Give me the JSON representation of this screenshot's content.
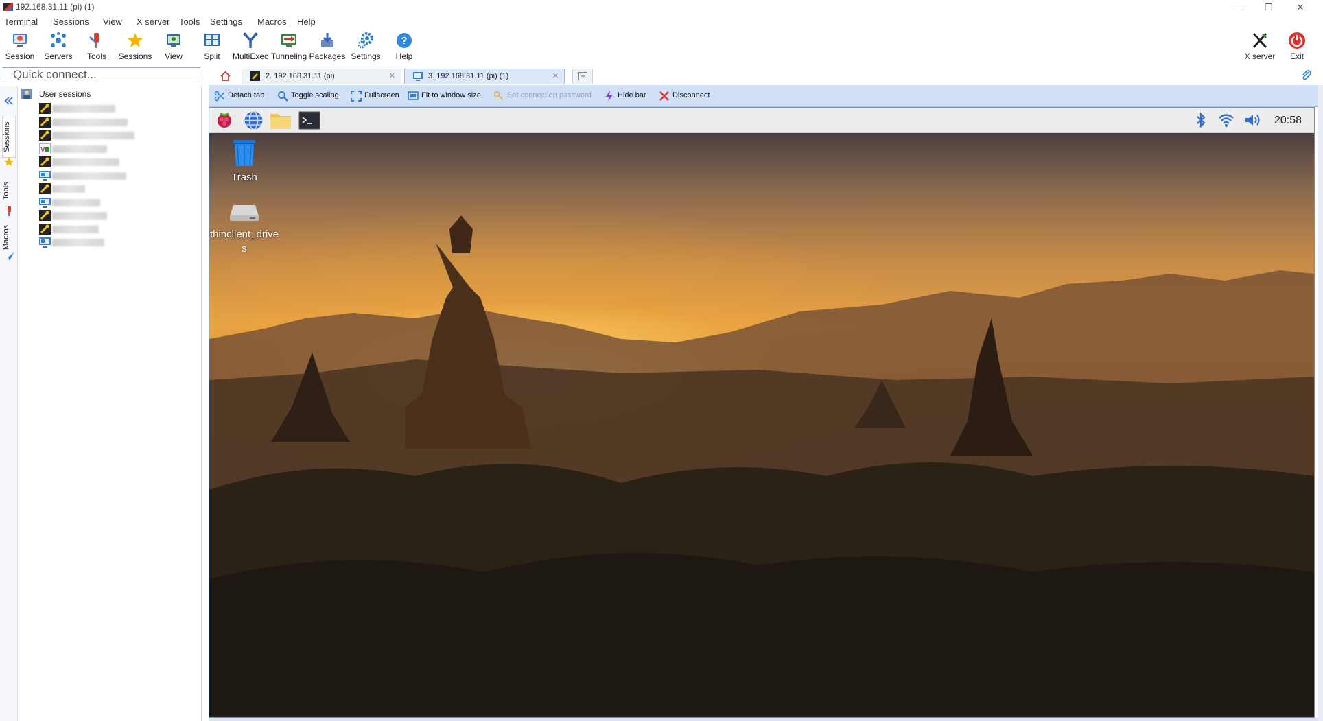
{
  "window": {
    "title": "192.168.31.11 (pi) (1)"
  },
  "window_controls": {
    "minimize": "—",
    "restore": "❐",
    "close": "✕"
  },
  "menu": [
    "Terminal",
    "Sessions",
    "View",
    "X server",
    "Tools",
    "Settings",
    "Macros",
    "Help"
  ],
  "toolbar": {
    "buttons": [
      "Session",
      "Servers",
      "Tools",
      "Sessions",
      "View",
      "Split",
      "MultiExec",
      "Tunneling",
      "Packages",
      "Settings",
      "Help"
    ],
    "right_buttons": [
      "X server",
      "Exit"
    ]
  },
  "quick_connect": {
    "placeholder": "Quick connect..."
  },
  "side_tabs": [
    "Sessions",
    "Tools",
    "Macros"
  ],
  "sessions": {
    "root_label": "User sessions",
    "items": [
      {
        "type": "ssh-icon"
      },
      {
        "type": "ssh-icon"
      },
      {
        "type": "ssh-icon"
      },
      {
        "type": "vnc-icon"
      },
      {
        "type": "ssh-icon"
      },
      {
        "type": "rdp-icon"
      },
      {
        "type": "ssh-icon"
      },
      {
        "type": "rdp-icon"
      },
      {
        "type": "ssh-icon"
      },
      {
        "type": "ssh-icon"
      },
      {
        "type": "rdp-icon"
      }
    ]
  },
  "tabs": [
    {
      "label": "2. 192.168.31.11 (pi)",
      "active": false
    },
    {
      "label": "3. 192.168.31.11 (pi) (1)",
      "active": true
    }
  ],
  "actions": [
    "Detach tab",
    "Toggle scaling",
    "Fullscreen",
    "Fit to window size",
    "Set connection password",
    "Hide bar",
    "Disconnect"
  ],
  "remote": {
    "clock": "20:58",
    "desktop_icons": [
      {
        "label": "Trash"
      },
      {
        "label": "thinclient_drives"
      }
    ]
  },
  "colors": {
    "accent": "#2f7fd8",
    "action_bar": "#cfe0f7",
    "close_red": "#e0302a"
  }
}
